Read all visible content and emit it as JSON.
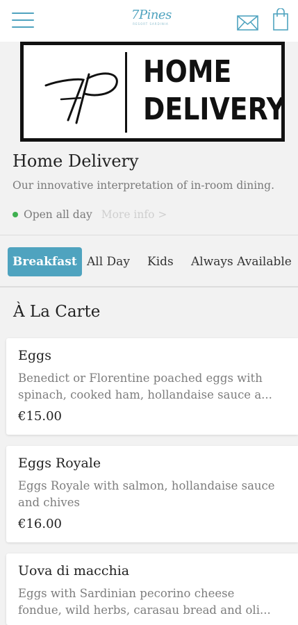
{
  "header": {
    "logo_text": "7Pines",
    "logo_tagline": "RESORT SARDINIA"
  },
  "banner": {
    "monogram": "7P",
    "title_line1": "HOME",
    "title_line2": "DELIVERY"
  },
  "venue": {
    "name": "Home Delivery",
    "description": "Our innovative interpretation of in-room dining.",
    "status": "Open all day",
    "status_color": "#3fb050",
    "more_info": "More info >"
  },
  "tabs": [
    {
      "label": "Breakfast",
      "active": true
    },
    {
      "label": "All Day",
      "active": false
    },
    {
      "label": "Kids",
      "active": false
    },
    {
      "label": "Always Available",
      "active": false
    }
  ],
  "section": {
    "title": "À La Carte"
  },
  "items": [
    {
      "name": "Eggs",
      "desc_line1": "Benedict or Florentine poached eggs with",
      "desc_line2": "spinach, cooked ham, hollandaise sauce a...",
      "price": "€15.00"
    },
    {
      "name": "Eggs Royale",
      "desc_line1": "Eggs Royale with salmon, hollandaise sauce",
      "desc_line2": "and chives",
      "price": "€16.00"
    },
    {
      "name": "Uova di macchia",
      "desc_line1": "Eggs with Sardinian pecorino cheese",
      "desc_line2": "fondue, wild herbs, carasau bread and oli...",
      "price": ""
    }
  ],
  "colors": {
    "accent": "#4fa3bf",
    "background": "#f2f2f2"
  }
}
